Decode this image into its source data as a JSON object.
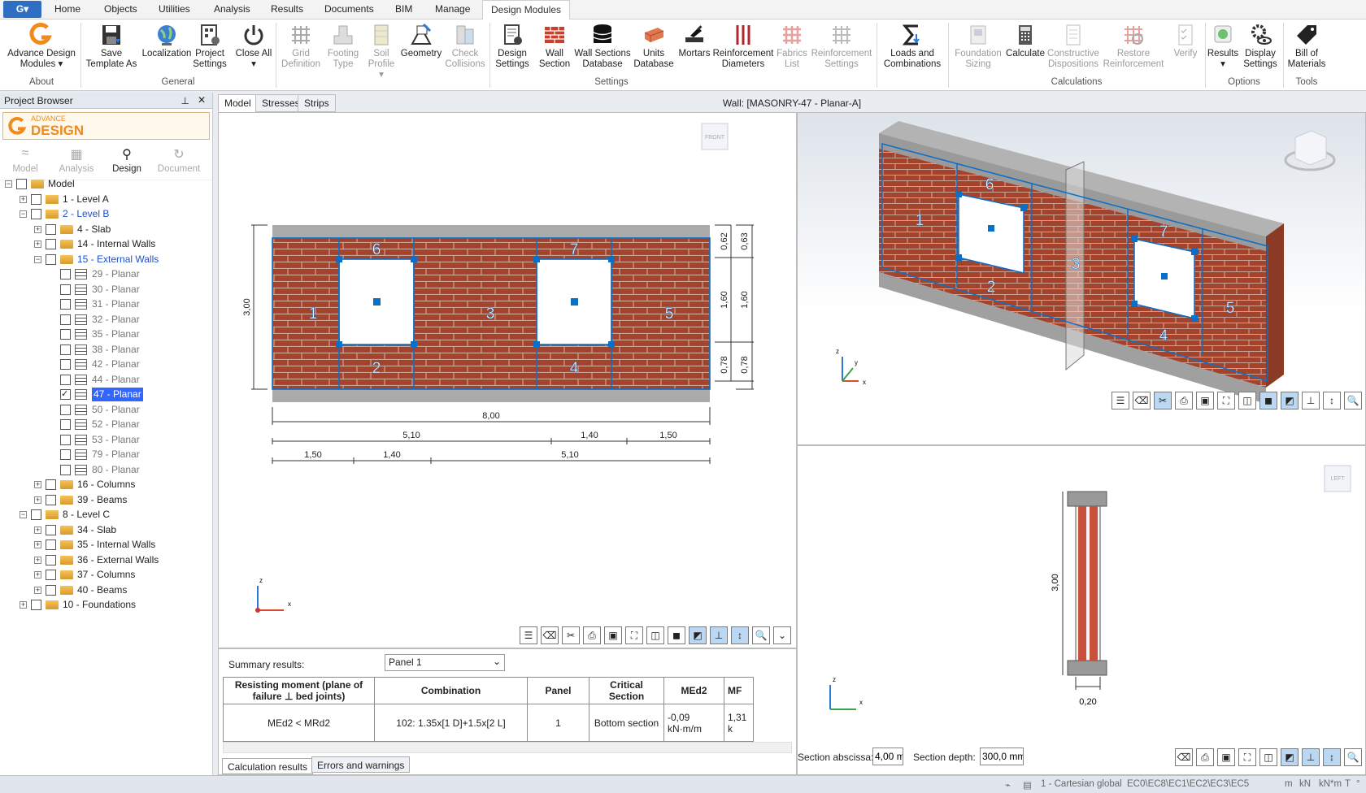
{
  "ribbon_tabs": [
    "Home",
    "Objects",
    "Utilities",
    "Analysis",
    "Results",
    "Documents",
    "BIM",
    "Manage",
    "Design Modules"
  ],
  "ribbon": {
    "about": {
      "btn": "Advance Design Modules",
      "group": "About"
    },
    "general": {
      "save": "Save Template As",
      "localization": "Localization",
      "project": "Project Settings",
      "close": "Close All",
      "group": "General"
    },
    "settings": {
      "grid": "Grid Definition",
      "footing": "Footing Type",
      "soil": "Soil Profile",
      "geometry": "Geometry",
      "check": "Check Collisions",
      "design": "Design Settings",
      "wall": "Wall Section",
      "wsdb": "Wall Sections Database",
      "units": "Units Database",
      "mortars": "Mortars",
      "reinf": "Reinforcement Diameters",
      "fabrics": "Fabrics List",
      "reinfset": "Reinforcement Settings",
      "loads": "Loads and Combinations",
      "group": "Settings"
    },
    "calculations": {
      "found": "Foundation Sizing",
      "calc": "Calculate",
      "constr": "Constructive Dispositions",
      "restore": "Restore Reinforcement",
      "verify": "Verify",
      "group": "Calculations"
    },
    "options": {
      "results": "Results",
      "display": "Display Settings",
      "group": "Options"
    },
    "tools": {
      "bill": "Bill of Materials",
      "group": "Tools"
    }
  },
  "browser": {
    "title": "Project Browser",
    "logo_small": "ADVANCE",
    "logo_big": "DESIGN",
    "modes": [
      "Model",
      "Analysis",
      "Design",
      "Document"
    ],
    "tree": [
      {
        "label": "Model"
      },
      {
        "label": "1 - Level A"
      },
      {
        "label": "2 - Level B"
      },
      {
        "label": "4 - Slab"
      },
      {
        "label": "14 - Internal Walls"
      },
      {
        "label": "15 - External Walls"
      },
      {
        "label": "29 - Planar"
      },
      {
        "label": "30 - Planar"
      },
      {
        "label": "31 - Planar"
      },
      {
        "label": "32 - Planar"
      },
      {
        "label": "35 - Planar"
      },
      {
        "label": "38 - Planar"
      },
      {
        "label": "42 - Planar"
      },
      {
        "label": "44 - Planar"
      },
      {
        "label": "47 - Planar"
      },
      {
        "label": "50 - Planar"
      },
      {
        "label": "52 - Planar"
      },
      {
        "label": "53 - Planar"
      },
      {
        "label": "79 - Planar"
      },
      {
        "label": "80 - Planar"
      },
      {
        "label": "16 - Columns"
      },
      {
        "label": "39 - Beams"
      },
      {
        "label": "8 - Level C"
      },
      {
        "label": "34 - Slab"
      },
      {
        "label": "35 - Internal Walls"
      },
      {
        "label": "36 - External Walls"
      },
      {
        "label": "37 - Columns"
      },
      {
        "label": "40 - Beams"
      },
      {
        "label": "10 - Foundations"
      }
    ]
  },
  "tabs": {
    "model": "Model",
    "stresses": "Stresses",
    "strips": "Strips"
  },
  "wall_title": "Wall: [MASONRY-47 - Planar-A]",
  "front": {
    "cube": "FRONT",
    "height": "3,00",
    "dims_right_a": [
      "0,62",
      "1,60",
      "0,78"
    ],
    "dims_right_b": [
      "0,63",
      "1,60",
      "0,78"
    ],
    "total": "8,00",
    "row1": [
      "5,10",
      "1,40",
      "1,50"
    ],
    "row2": [
      "1,50",
      "1,40",
      "5,10"
    ],
    "panels": [
      "1",
      "2",
      "3",
      "4",
      "5",
      "6",
      "7"
    ],
    "axis_z": "z",
    "axis_x": "x"
  },
  "view3d": {
    "panels": [
      "1",
      "2",
      "3",
      "4",
      "5",
      "6",
      "7"
    ],
    "axis_z": "z",
    "axis_y": "y",
    "axis_x": "x"
  },
  "left": {
    "cube": "LEFT",
    "height": "3,00",
    "thickness": "0,20",
    "axis_z": "z",
    "axis_x": "x",
    "section_abscissa_label": "Section abscissa:",
    "section_abscissa": "4,00 m",
    "section_depth_label": "Section depth:",
    "section_depth": "300,0 mm"
  },
  "results": {
    "summary_label": "Summary results:",
    "panel_select": "Panel 1",
    "headers": [
      "Resisting moment (plane of failure ⊥ bed joints)",
      "Combination",
      "Panel",
      "Critical Section",
      "MEd2",
      "MF"
    ],
    "row": [
      "MEd2 < MRd2",
      "102: 1.35x[1 D]+1.5x[2 L]",
      "1",
      "Bottom section",
      "-0,09 kN·m/m",
      "1,31 k"
    ],
    "tab_calc": "Calculation results",
    "tab_err": "Errors and warnings"
  },
  "status": {
    "coord": "1 - Cartesian global",
    "codes": "EC0\\EC8\\EC1\\EC2\\EC3\\EC5",
    "u1": "m",
    "u2": "kN",
    "u3": "kN*m",
    "u4": "T",
    "u5": "°"
  },
  "colors": {
    "accent": "#0b6fc6",
    "brick": "#a4432c",
    "concrete": "#a9a9a9",
    "active_tab": "#f7c342"
  }
}
